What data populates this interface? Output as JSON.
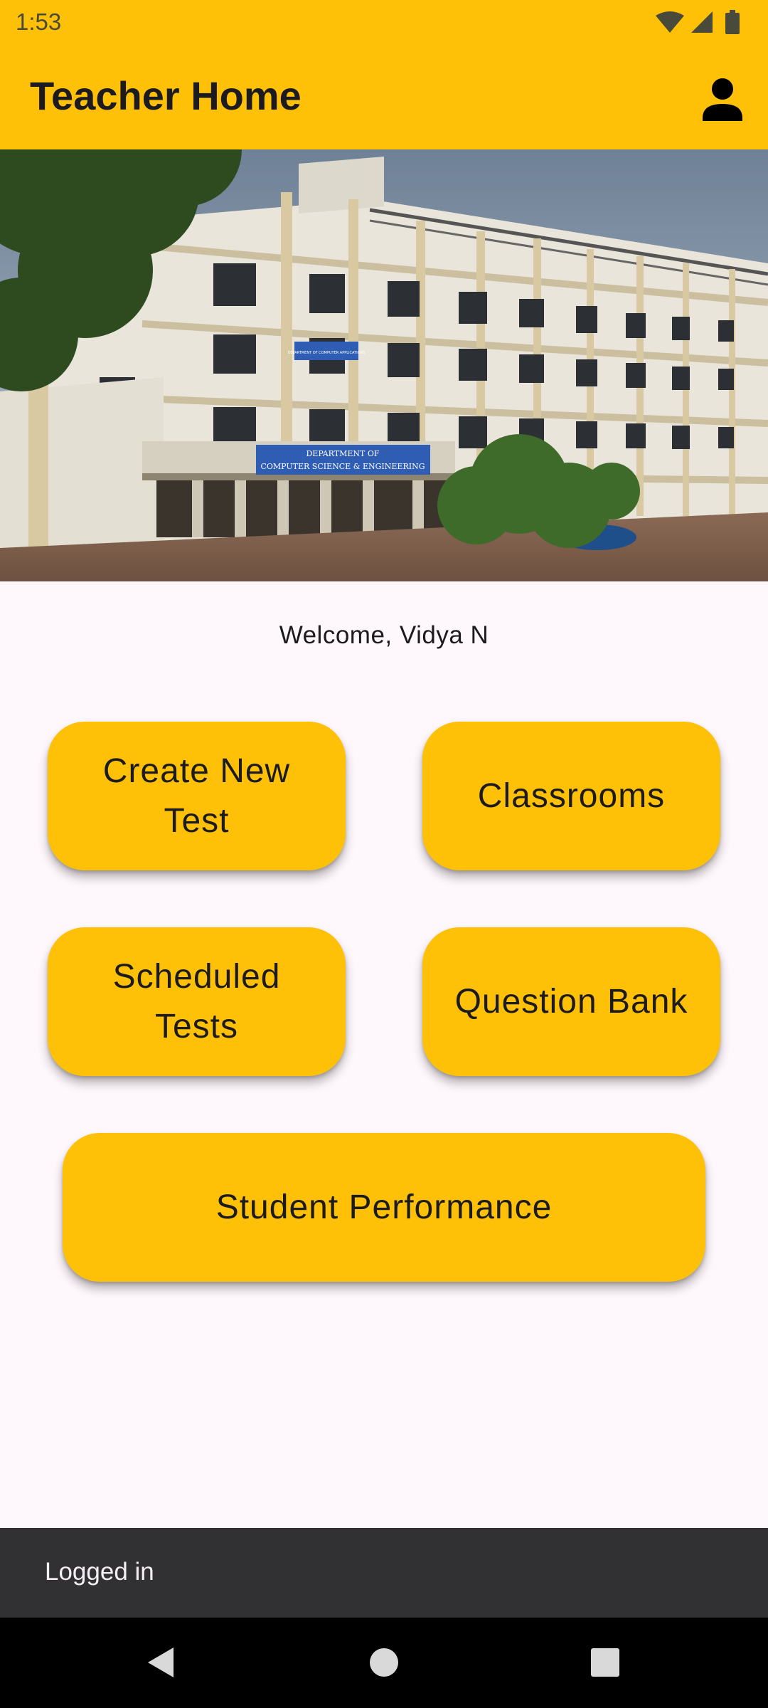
{
  "status_bar": {
    "time": "1:53",
    "icons": [
      "wifi-icon",
      "signal-icon",
      "battery-icon"
    ]
  },
  "app_bar": {
    "title": "Teacher Home",
    "profile_icon": "account-icon"
  },
  "hero": {
    "sign_line1": "DEPARTMENT OF",
    "sign_line2": "COMPUTER SCIENCE & ENGINEERING",
    "small_sign": "DEPARTMENT OF COMPUTER APPLICATIONS"
  },
  "welcome_text": "Welcome, Vidya N",
  "tiles": {
    "create_new_test": "Create New Test",
    "classrooms": "Classrooms",
    "scheduled_tests": "Scheduled Tests",
    "question_bank": "Question Bank",
    "student_performance": "Student Performance"
  },
  "snackbar": {
    "message": "Logged in"
  },
  "colors": {
    "accent": "#FFC107",
    "background": "#FEF7FB",
    "snackbar": "#313033",
    "nav_bar": "#000000"
  },
  "nav_bar": {
    "icons": [
      "back-icon",
      "home-icon",
      "recents-icon"
    ]
  }
}
